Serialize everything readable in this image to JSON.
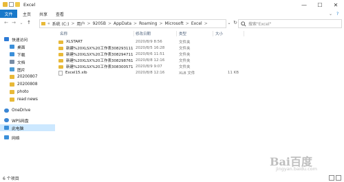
{
  "window": {
    "title": "Excel",
    "minimize": "—",
    "maximize": "☐",
    "close": "✕"
  },
  "ribbon": {
    "tabs": [
      "文件",
      "主页",
      "共享",
      "查看"
    ],
    "expand": "⌄",
    "help": "?"
  },
  "nav": {
    "back": "←",
    "forward": "→",
    "recent": "⌄",
    "up": "↑"
  },
  "address": {
    "crumbs": [
      "系统 (C:)",
      "用户",
      "9205B",
      "AppData",
      "Roaming",
      "Microsoft",
      "Excel"
    ],
    "separator": ">",
    "prefix": "«",
    "dropdown": "⌄",
    "refresh": "↻"
  },
  "search": {
    "placeholder": "搜索\"Excel\"",
    "icon": "search-icon"
  },
  "sidebar": {
    "items": [
      {
        "label": "快速访问",
        "icon": "star-icon",
        "color": "#2d7bd6"
      },
      {
        "label": "桌面",
        "icon": "desktop-icon",
        "color": "#3b8fd9"
      },
      {
        "label": "下载",
        "icon": "download-icon",
        "color": "#3b8fd9"
      },
      {
        "label": "文档",
        "icon": "document-icon",
        "color": "#7a8ea6"
      },
      {
        "label": "图片",
        "icon": "picture-icon",
        "color": "#4a9bd6"
      },
      {
        "label": "20200807",
        "icon": "folder-icon",
        "color": "#e8b938"
      },
      {
        "label": "20200808",
        "icon": "folder-icon",
        "color": "#e8b938"
      },
      {
        "label": "photo",
        "icon": "folder-icon",
        "color": "#e8b938"
      },
      {
        "label": "read news",
        "icon": "folder-icon",
        "color": "#e8b938"
      },
      {
        "label": "OneDrive",
        "icon": "cloud-icon",
        "color": "#3a86d4"
      },
      {
        "label": "WPS网盘",
        "icon": "cloud-icon",
        "color": "#3a86d4"
      },
      {
        "label": "此电脑",
        "icon": "computer-icon",
        "color": "#3b8fd9"
      },
      {
        "label": "网络",
        "icon": "network-icon",
        "color": "#3b8fd9"
      }
    ]
  },
  "columns": [
    "名称",
    "修改日期",
    "类型",
    "大小"
  ],
  "files": [
    {
      "name": "XLSTART",
      "date": "2020/8/9 8:56",
      "type": "文件夹",
      "size": "",
      "kind": "folder"
    },
    {
      "name": "新建%20XLSX%20工作表30829311172...",
      "date": "2020/8/5 16:28",
      "type": "文件夹",
      "size": "",
      "kind": "folder"
    },
    {
      "name": "新建%20XLSX%20工作表30829471114...",
      "date": "2020/8/6 11:51",
      "type": "文件夹",
      "size": "",
      "kind": "folder"
    },
    {
      "name": "新建%20XLSX%20工作表30829876124...",
      "date": "2020/8/8 12:16",
      "type": "文件夹",
      "size": "",
      "kind": "folder"
    },
    {
      "name": "新建%20XLSX%20工作表30830057176...",
      "date": "2020/8/9 9:07",
      "type": "文件夹",
      "size": "",
      "kind": "folder"
    },
    {
      "name": "Excel15.xlb",
      "date": "2020/8/8 12:16",
      "type": "XLB 文件",
      "size": "11 KB",
      "kind": "file"
    }
  ],
  "status": {
    "count": "6 个项目"
  },
  "watermark": {
    "main": "Bai百度",
    "sub": "jingyan.baidu.com"
  },
  "accent": "#1979ca"
}
